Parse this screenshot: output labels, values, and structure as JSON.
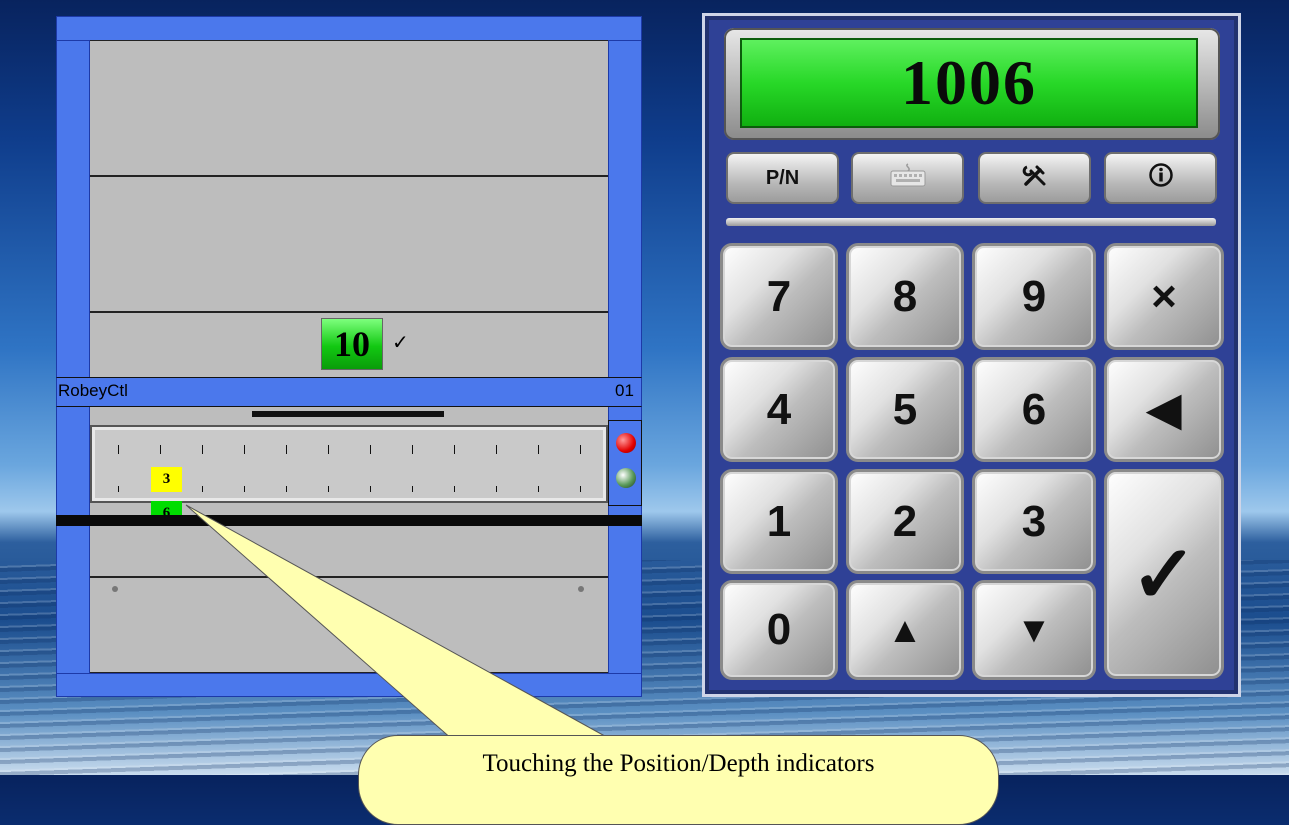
{
  "cabinet": {
    "title": "RobeyCtl",
    "number": "01",
    "quantity_value": "10",
    "quantity_check": "✓",
    "position_marker": "3",
    "depth_marker": "6",
    "colors": {
      "frame": "#4b78ec",
      "panel": "#bdbdbd",
      "position": "#ffff00",
      "depth": "#00dd00"
    }
  },
  "keypad": {
    "display_value": "1006",
    "function_buttons": [
      {
        "label": "P/N",
        "icon": "pn-text"
      },
      {
        "label": "",
        "icon": "keyboard-icon"
      },
      {
        "label": "",
        "icon": "tools-icon"
      },
      {
        "label": "",
        "icon": "info-icon"
      }
    ],
    "keys": {
      "k7": "7",
      "k8": "8",
      "k9": "9",
      "clear": "×",
      "k4": "4",
      "k5": "5",
      "k6": "6",
      "back": "◀",
      "k1": "1",
      "k2": "2",
      "k3": "3",
      "enter": "✓",
      "k0": "0",
      "up": "▲",
      "down": "▼"
    }
  },
  "callout": {
    "text": "Touching the Position/Depth indicators"
  }
}
